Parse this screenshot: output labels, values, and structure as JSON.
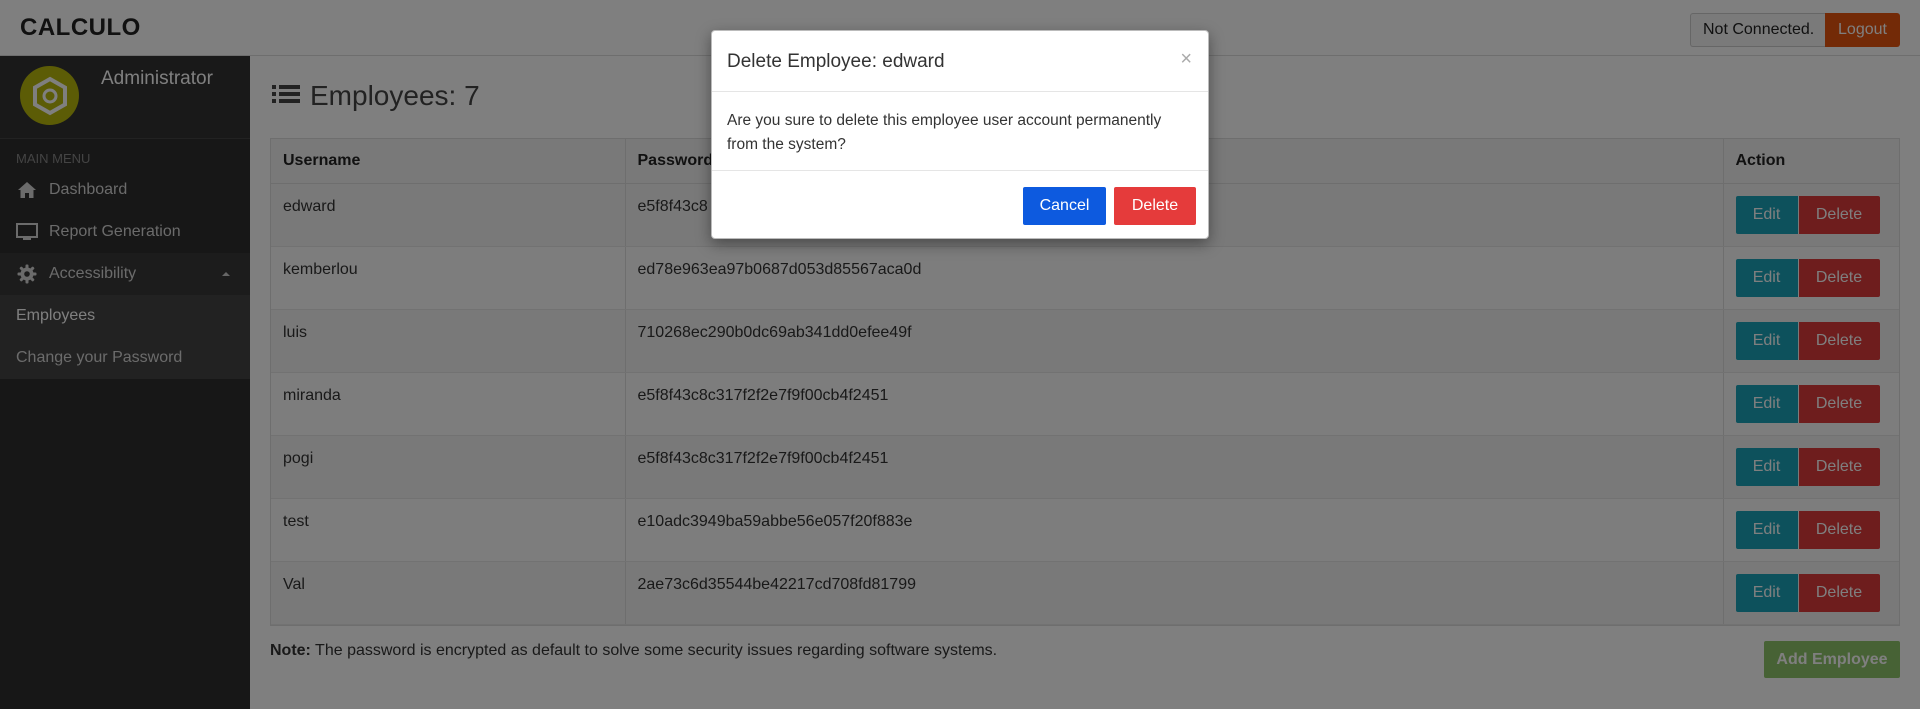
{
  "header": {
    "brand": "CALCULO",
    "status_text": "Not Connected.",
    "logout_label": "Logout"
  },
  "sidebar": {
    "profile_name": "Administrator",
    "menu_header": "MAIN MENU",
    "items": [
      {
        "label": "Dashboard",
        "icon": "home-icon"
      },
      {
        "label": "Report Generation",
        "icon": "monitor-icon"
      },
      {
        "label": "Accessibility",
        "icon": "gear-icon"
      }
    ],
    "sub_items": [
      {
        "label": "Employees"
      },
      {
        "label": "Change your Password"
      }
    ]
  },
  "main": {
    "title": "Employees: 7",
    "table": {
      "headers": [
        "Username",
        "Password",
        "Action"
      ],
      "rows": [
        {
          "username": "edward",
          "password": "e5f8f43c8"
        },
        {
          "username": "kemberlou",
          "password": "ed78e963ea97b0687d053d85567aca0d"
        },
        {
          "username": "luis",
          "password": "710268ec290b0dc69ab341dd0efee49f"
        },
        {
          "username": "miranda",
          "password": "e5f8f43c8c317f2f2e7f9f00cb4f2451"
        },
        {
          "username": "pogi",
          "password": "e5f8f43c8c317f2f2e7f9f00cb4f2451"
        },
        {
          "username": "test",
          "password": "e10adc3949ba59abbe56e057f20f883e"
        },
        {
          "username": "Val",
          "password": "2ae73c6d35544be42217cd708fd81799"
        }
      ],
      "edit_label": "Edit",
      "delete_label": "Delete"
    },
    "note_label": "Note:",
    "note_text": " The password is encrypted as default to solve some security issues regarding software systems.",
    "add_label": "Add Employee"
  },
  "modal": {
    "title": "Delete Employee: edward",
    "close": "×",
    "body": "Are you sure to delete this employee user account permanently from the system?",
    "cancel_label": "Cancel",
    "confirm_label": "Delete"
  },
  "colors": {
    "brand_accent": "#e6540e",
    "sidebar_bg": "#2e2e2e",
    "edit_button": "#1aa3b9",
    "delete_button": "#dd3a3a",
    "cancel_button": "#0d5adf",
    "add_button": "#8fc46a",
    "avatar": "#b8b80c"
  }
}
